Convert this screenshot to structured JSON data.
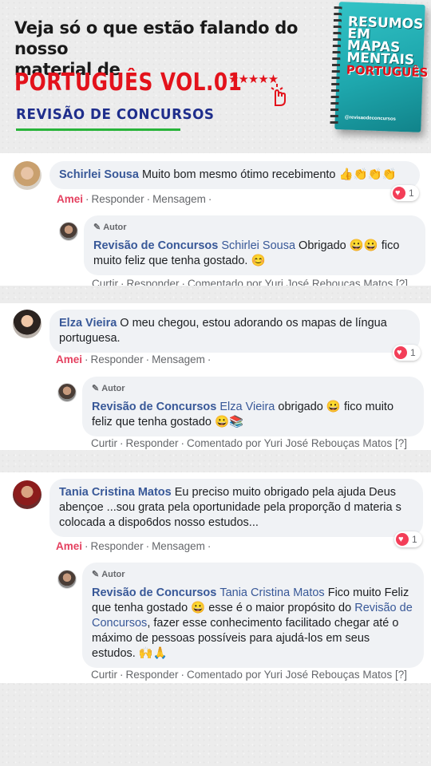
{
  "header": {
    "headline_line1": "Veja só o que estão falando do nosso",
    "headline_line2": "material de",
    "product": "PORTUGUÊS VOL.01",
    "tagline": "REVISÃO DE CONCURSOS",
    "stars": "★★★★★",
    "book": {
      "line1": "RESUMOS",
      "line2": "EM",
      "line3": "MAPAS",
      "line4": "MENTAIS",
      "line5": "PORTUGUÊS",
      "handle": "@revisaodeconcursos"
    }
  },
  "comments": [
    {
      "author": "Schirlei Sousa",
      "text": "Muito bom mesmo ótimo recebimento 👍👏👏👏",
      "actions": {
        "love": "Amei",
        "reply": "Responder",
        "message": "Mensagem"
      },
      "reactions": "1",
      "reply": {
        "badge": "Autor",
        "author": "Revisão de Concursos",
        "mention": "Schirlei Sousa",
        "text_a": "Obrigado 😀😀 fico muito feliz que tenha gostado. 😊",
        "actions": {
          "like": "Curtir",
          "reply": "Responder",
          "commented_by": "Comentado por Yuri José Rebouças Matos",
          "help": "[?]"
        }
      }
    },
    {
      "author": "Elza Vieira",
      "text": "O meu chegou, estou adorando os mapas de língua portuguesa.",
      "actions": {
        "love": "Amei",
        "reply": "Responder",
        "message": "Mensagem"
      },
      "reactions": "1",
      "reply": {
        "badge": "Autor",
        "author": "Revisão de Concursos",
        "mention": "Elza Vieira",
        "text_a": "obrigado 😀 fico muito feliz que tenha gostado 😀📚",
        "actions": {
          "like": "Curtir",
          "reply": "Responder",
          "commented_by": "Comentado por Yuri José Rebouças Matos",
          "help": "[?]"
        }
      }
    },
    {
      "author": "Tania Cristina Matos",
      "text": "Eu preciso muito obrigado pela ajuda Deus abençoe ...sou grata pela oportunidade pela proporção d materia s colocada a dispo6dos nosso estudos...",
      "actions": {
        "love": "Amei",
        "reply": "Responder",
        "message": "Mensagem"
      },
      "reactions": "1",
      "reply": {
        "badge": "Autor",
        "author": "Revisão de Concursos",
        "mention": "Tania Cristina Matos",
        "text_a": "Fico muito Feliz que tenha gostado 😀 esse é o maior propósito do",
        "mention2": "Revisão de Concursos",
        "text_b": ", fazer esse conhecimento facilitado chegar até o máximo de pessoas possíveis para ajudá-los em seus estudos. 🙌🙏",
        "actions": {
          "like": "Curtir",
          "reply": "Responder",
          "commented_by": "Comentado por Yuri José Rebouças Matos",
          "help": "[?]"
        }
      }
    }
  ]
}
